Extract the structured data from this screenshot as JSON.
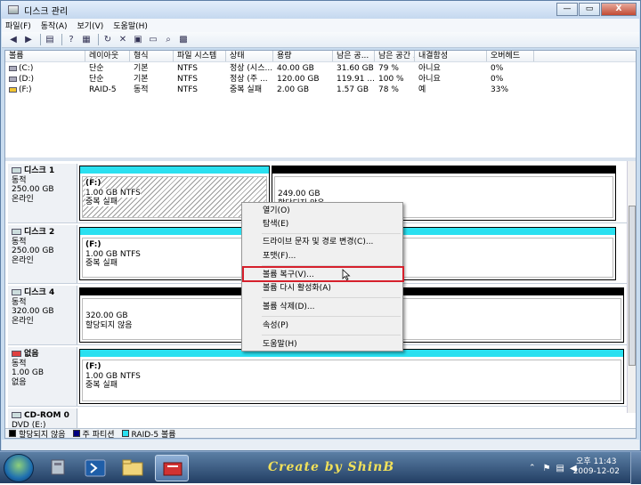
{
  "window": {
    "title": "디스크 관리",
    "buttons": {
      "minimize": "—",
      "maximize": "▭",
      "close": "X"
    }
  },
  "menu": [
    "파일(F)",
    "동작(A)",
    "보기(V)",
    "도움말(H)"
  ],
  "volumes": {
    "headers": [
      "볼륨",
      "레이아웃",
      "형식",
      "파일 시스템",
      "상태",
      "용량",
      "남은 공...",
      "남은 공간 ...",
      "내결함성",
      "오버헤드"
    ],
    "rows": [
      [
        "(C:)",
        "단순",
        "기본",
        "NTFS",
        "정상 (시스...",
        "40.00 GB",
        "31.60 GB",
        "79 %",
        "아니요",
        "0%"
      ],
      [
        "(D:)",
        "단순",
        "기본",
        "NTFS",
        "정상 (주 ...",
        "120.00 GB",
        "119.91 ...",
        "100 %",
        "아니요",
        "0%"
      ],
      [
        "(F:)",
        "RAID-5",
        "동적",
        "NTFS",
        "중복 실패",
        "2.00 GB",
        "1.57 GB",
        "78 %",
        "예",
        "33%"
      ]
    ]
  },
  "disks": [
    {
      "name": "디스크 1",
      "type": "동적",
      "size": "250.00 GB",
      "status": "온라인",
      "p1": {
        "name": "(F:)",
        "info": "1.00 GB NTFS",
        "state": "중복 실패"
      },
      "p2": {
        "name": "",
        "info": "249.00 GB",
        "state": "할당되지 않음"
      }
    },
    {
      "name": "디스크 2",
      "type": "동적",
      "size": "250.00 GB",
      "status": "온라인",
      "p1": {
        "name": "(F:)",
        "info": "1.00 GB NTFS",
        "state": "중복 실패"
      }
    },
    {
      "name": "디스크 4",
      "type": "동적",
      "size": "320.00 GB",
      "status": "온라인",
      "p1": {
        "name": "",
        "info": "320.00 GB",
        "state": "할당되지 않음"
      }
    },
    {
      "name": "없음",
      "type": "동적",
      "size": "1.00 GB",
      "status": "없음",
      "p1": {
        "name": "(F:)",
        "info": "1.00 GB NTFS",
        "state": "중복 실패"
      }
    },
    {
      "name": "CD-ROM 0",
      "type": "DVD (E:)"
    }
  ],
  "legend": [
    "할당되지 않음",
    "주 파티션",
    "RAID-5 볼륨"
  ],
  "context_menu": [
    "열기(O)",
    "탐색(E)",
    "드라이브 문자 및 경로 변경(C)...",
    "포맷(F)...",
    "볼륨 복구(V)...",
    "볼륨 다시 활성화(A)",
    "볼륨 삭제(D)...",
    "속성(P)",
    "도움말(H)"
  ],
  "taskbar": {
    "watermark": "Create by ShinB",
    "time": "오후 11:43",
    "date": "2009-12-02"
  },
  "colors": {
    "raid5": "#2ae0f0",
    "primary": "#000080",
    "unallocated": "#000000",
    "highlight": "#d6202c"
  }
}
